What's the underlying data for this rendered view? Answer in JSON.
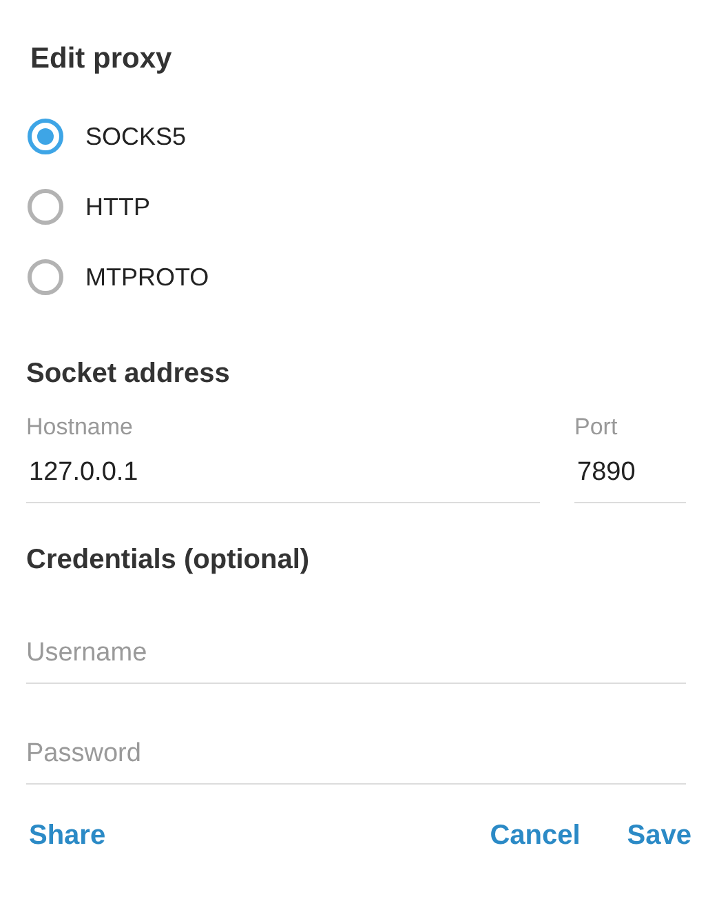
{
  "title": "Edit proxy",
  "proxy_types": [
    {
      "label": "SOCKS5",
      "selected": true
    },
    {
      "label": "HTTP",
      "selected": false
    },
    {
      "label": "MTPROTO",
      "selected": false
    }
  ],
  "socket_address": {
    "heading": "Socket address",
    "hostname": {
      "label": "Hostname",
      "value": "127.0.0.1"
    },
    "port": {
      "label": "Port",
      "value": "7890"
    }
  },
  "credentials": {
    "heading": "Credentials (optional)",
    "username": {
      "placeholder": "Username"
    },
    "password": {
      "placeholder": "Password"
    }
  },
  "buttons": {
    "left": [
      "Share"
    ],
    "right": [
      "Cancel",
      "Save"
    ]
  }
}
